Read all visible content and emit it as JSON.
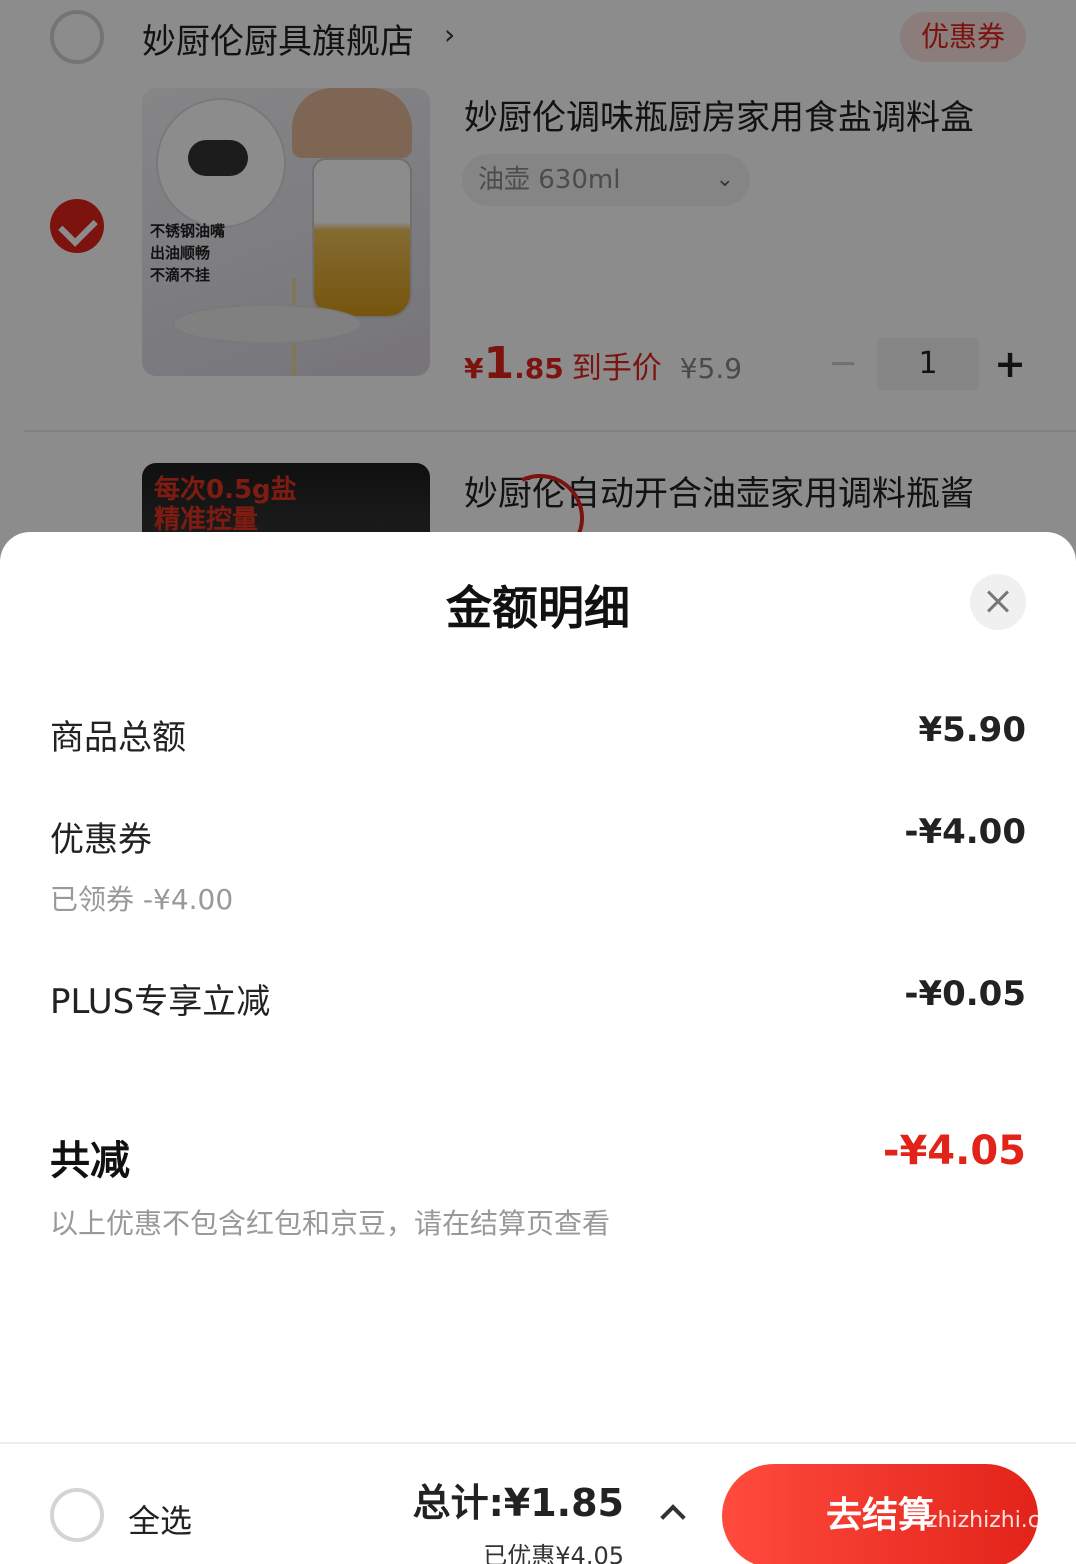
{
  "cart": {
    "shop": {
      "name": "妙厨伦厨具旗舰店",
      "arrow": "›",
      "coupon_tag": "优惠券"
    },
    "items": [
      {
        "title": "妙厨伦调味瓶厨房家用食盐调料盒",
        "image_text": [
          "不锈钢油嘴",
          "出油顺畅",
          "不滴不挂"
        ],
        "spec": "油壶 630ml",
        "spec_arrow": "⌄",
        "price_symbol": "¥",
        "price_int": "1",
        "price_dec": ".85",
        "price_label": "到手价",
        "orig_price": "¥5.9",
        "qty": "1",
        "minus": "−",
        "plus": "+",
        "checked": true
      },
      {
        "title": "妙厨伦自动开合油壶家用调料瓶酱",
        "image_text": [
          "每次0.5g盐",
          "精准控量"
        ]
      }
    ]
  },
  "sheet": {
    "title": "金额明细",
    "rows": [
      {
        "label": "商品总额",
        "value": "¥5.90"
      },
      {
        "label": "优惠券",
        "value": "-¥4.00",
        "sub": "已领券 -¥4.00"
      },
      {
        "label": "PLUS专享立减",
        "value": "-¥0.05"
      }
    ],
    "total": {
      "label": "共减",
      "value": "-¥4.05"
    },
    "note": "以上优惠不包含红包和京豆，请在结算页查看"
  },
  "footer": {
    "select_all": "全选",
    "total": "总计:¥1.85",
    "saved": "已优惠¥4.05",
    "checkout": "去结算",
    "watermark": "zhizhizhi.com"
  },
  "colors": {
    "accent": "#e2231a",
    "coupon_bg": "#fde4e2"
  }
}
